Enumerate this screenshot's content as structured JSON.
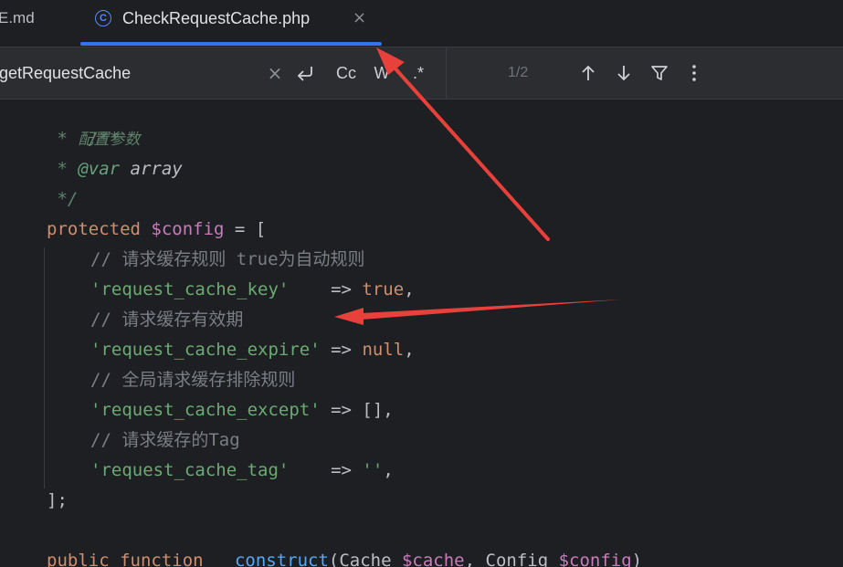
{
  "tabs": [
    {
      "label": "E.md",
      "active": false
    },
    {
      "label": "CheckRequestCache.php",
      "active": true,
      "icon": "class-icon",
      "icon_glyph": "C"
    }
  ],
  "tab_close_glyph": "×",
  "search": {
    "value": "getRequestCache",
    "clear_glyph": "×",
    "regex_toggle_glyph": "⮐",
    "case_label": "Cc",
    "words_label": "W",
    "regex_label": ".*",
    "match_count": "1/2",
    "prev_glyph": "↑",
    "next_glyph": "↓",
    "filter_glyph": "⛉",
    "more_glyph": "⋮"
  },
  "code": {
    "l1": "/**",
    "l2_star": " * ",
    "l2_text": "配置参数",
    "l3_star": " * ",
    "l3_tag": "@var",
    "l3_type": " array",
    "l4": " */",
    "l5_kw": "protected",
    "l5_var": "$config",
    "l5_rest": " = [",
    "l6": "// 请求缓存规则 true为自动规则",
    "l7_str": "'request_cache_key'",
    "l7_arrow": "    => ",
    "l7_val": "true",
    "l7_end": ",",
    "l8": "// 请求缓存有效期",
    "l9_str": "'request_cache_expire'",
    "l9_arrow": " => ",
    "l9_val": "null",
    "l9_end": ",",
    "l10": "// 全局请求缓存排除规则",
    "l11_str": "'request_cache_except'",
    "l11_arrow": " => [],",
    "l12": "// 请求缓存的Tag",
    "l13_str": "'request_cache_tag'",
    "l13_arrow": "    => ",
    "l13_val": "''",
    "l13_end": ",",
    "l14": "];",
    "l16_kw1": "public",
    "l16_kw2": "function",
    "l16_fn": "__construct",
    "l16_p1": "(Cache ",
    "l16_v1": "$cache",
    "l16_p2": ", Config ",
    "l16_v2": "$config",
    "l16_p3": ")"
  },
  "colors": {
    "accent": "#3574f0",
    "annotation_arrow": "#e8403a"
  }
}
